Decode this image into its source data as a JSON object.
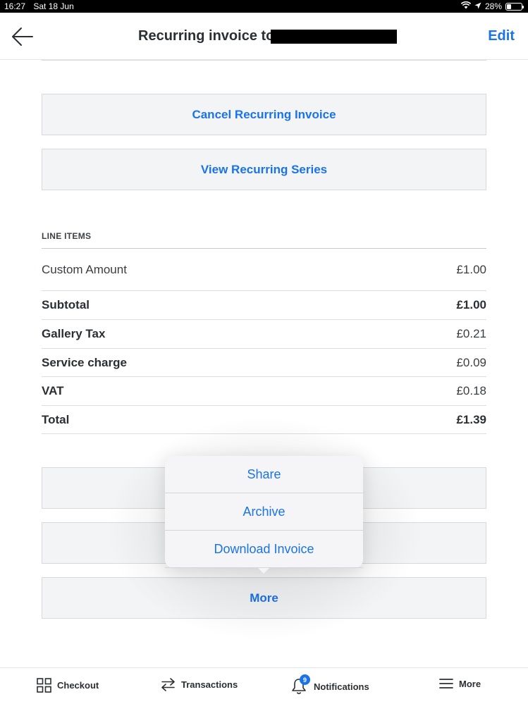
{
  "status_bar": {
    "time": "16:27",
    "date": "Sat 18 Jun",
    "battery": "28%",
    "battery_level": 0.28
  },
  "header": {
    "title": "Recurring invoice to",
    "edit_label": "Edit"
  },
  "actions": {
    "cancel_label": "Cancel Recurring Invoice",
    "view_series_label": "View Recurring Series",
    "more_label": "More"
  },
  "line_items": {
    "section_label": "LINE ITEMS",
    "rows": [
      {
        "label": "Custom Amount",
        "amount": "£1.00"
      },
      {
        "label": "Subtotal",
        "amount": "£1.00"
      },
      {
        "label": "Gallery Tax",
        "amount": "£0.21"
      },
      {
        "label": "Service charge",
        "amount": "£0.09"
      },
      {
        "label": "VAT",
        "amount": "£0.18"
      },
      {
        "label": "Total",
        "amount": "£1.39"
      }
    ]
  },
  "popover": {
    "items": [
      "Share",
      "Archive",
      "Download Invoice"
    ]
  },
  "tabbar": {
    "checkout": "Checkout",
    "transactions": "Transactions",
    "notifications": "Notifications",
    "notifications_badge": "9",
    "more": "More"
  },
  "colors": {
    "accent": "#1a73e8",
    "button_bg": "#f3f4f6"
  }
}
